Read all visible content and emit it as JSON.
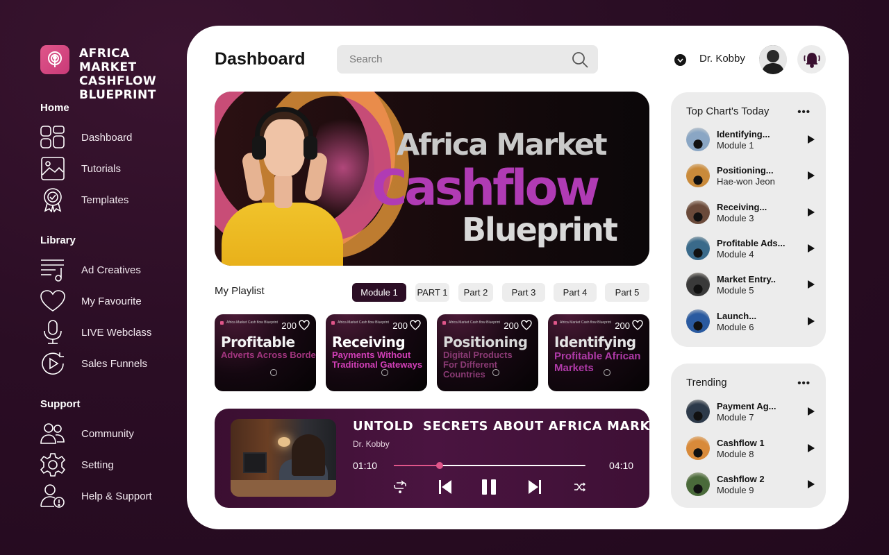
{
  "brand": {
    "name": "AFRICA MARKET CASHFLOW BLUEPRINT",
    "lines": [
      "AFRICA",
      "MARKET",
      "CASHFLOW",
      "BLUEPRINT"
    ]
  },
  "sidebar": {
    "sections": [
      {
        "title": "Home",
        "items": [
          {
            "label": "Dashboard",
            "icon": "grid-icon"
          },
          {
            "label": "Tutorials",
            "icon": "image-icon"
          },
          {
            "label": "Templates",
            "icon": "badge-icon"
          }
        ]
      },
      {
        "title": "Library",
        "items": [
          {
            "label": "Ad Creatives",
            "icon": "music-list-icon"
          },
          {
            "label": "My Favourite",
            "icon": "heart-icon"
          },
          {
            "label": "LIVE Webclass",
            "icon": "microphone-icon"
          },
          {
            "label": "Sales Funnels",
            "icon": "play-circle-icon"
          }
        ]
      },
      {
        "title": "Support",
        "items": [
          {
            "label": "Community",
            "icon": "users-icon"
          },
          {
            "label": "Setting",
            "icon": "gear-icon"
          },
          {
            "label": "Help & Support",
            "icon": "user-alert-icon"
          }
        ]
      }
    ]
  },
  "header": {
    "title": "Dashboard",
    "search_placeholder": "Search",
    "user_name": "Dr. Kobby"
  },
  "hero": {
    "line1": "Africa Market",
    "line2": "Cashflow",
    "line3": "Blueprint"
  },
  "playlist": {
    "title": "My Playlist",
    "tabs": [
      "Module 1",
      "PART 1",
      "Part 2",
      "Part 3",
      "Part 4",
      "Part 5"
    ],
    "active_tab": "Module 1",
    "cards": [
      {
        "brand": "Africa Market Cash flow Blueprint",
        "count": "200",
        "title": "Profitable",
        "subtitle": "Adverts Across Borders",
        "sub_color": "#a2357f"
      },
      {
        "brand": "Africa Market Cash flow Blueprint",
        "count": "200",
        "title": "Receiving",
        "subtitle": "Payments Without Traditional Gateways",
        "sub_color": "#d13fb7"
      },
      {
        "brand": "Africa Market Cash flow Blueprint",
        "count": "200",
        "title": "Positioning",
        "subtitle": "Digital Products For Different Countries",
        "sub_color": "#8a3a74"
      },
      {
        "brand": "Africa Market Cash flow Blueprint",
        "count": "200",
        "title": "Identifying",
        "subtitle": "Profitable African Markets",
        "sub_color": "#b03aa8"
      }
    ]
  },
  "player": {
    "title": "UNTOLD  SECRETS ABOUT AFRICA MARKET",
    "artist": "Dr. Kobby",
    "current_time": "01:10",
    "total_time": "04:10",
    "progress": 0.24
  },
  "top_charts": {
    "title": "Top Chart's Today",
    "more": "•••",
    "items": [
      {
        "title": "Identifying...",
        "subtitle": "Module 1",
        "thumb": "#8aa6c4"
      },
      {
        "title": "Positioning...",
        "subtitle": "Hae-won Jeon",
        "thumb": "#c98a3a"
      },
      {
        "title": "Receiving...",
        "subtitle": "Module 3",
        "thumb": "#6a4a3a"
      },
      {
        "title": "Profitable Ads...",
        "subtitle": "Module 4",
        "thumb": "#3a6a8a"
      },
      {
        "title": "Market Entry..",
        "subtitle": "Module 5",
        "thumb": "#3a3a3a"
      },
      {
        "title": "Launch...",
        "subtitle": "Module 6",
        "thumb": "#2a5aa0"
      }
    ]
  },
  "trending": {
    "title": "Trending",
    "more": "•••",
    "items": [
      {
        "title": "Payment Ag...",
        "subtitle": "Module 7",
        "thumb": "#2d3a4a"
      },
      {
        "title": "Cashflow 1",
        "subtitle": "Module 8",
        "thumb": "#d88a3a"
      },
      {
        "title": "Cashflow 2",
        "subtitle": "Module 9",
        "thumb": "#4a6a3a"
      }
    ]
  },
  "colors": {
    "accent": "#e0568a",
    "dark": "#2c0e25",
    "background": "#2a0d24"
  }
}
